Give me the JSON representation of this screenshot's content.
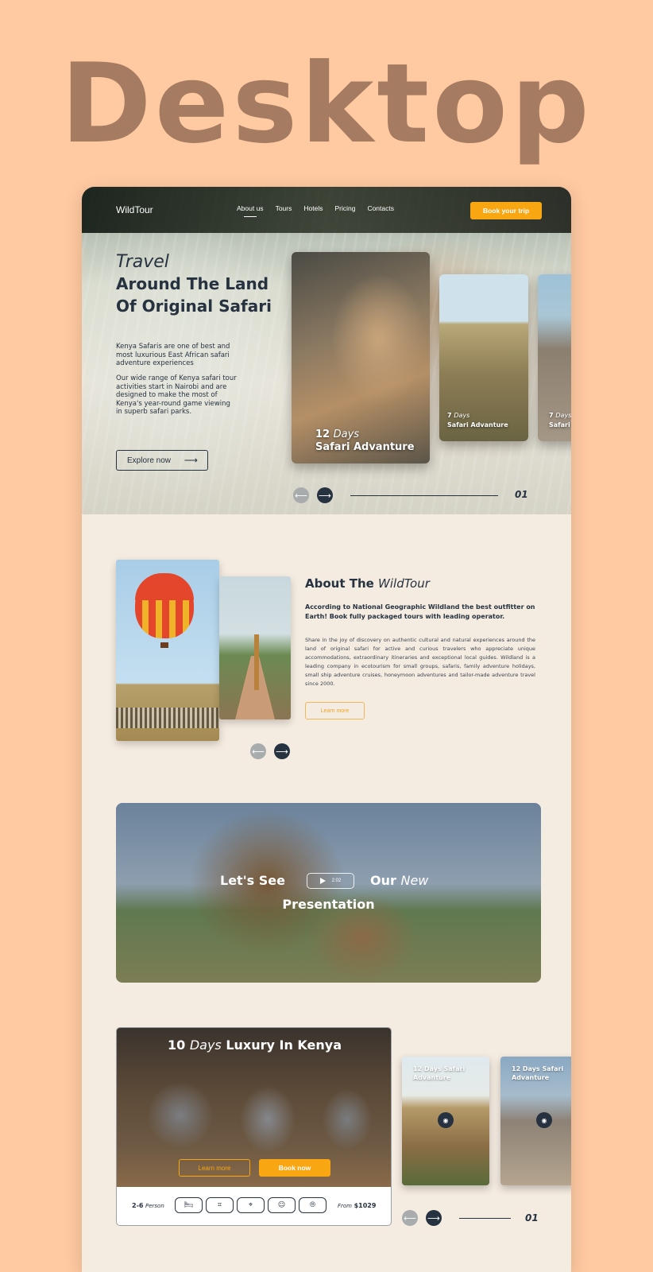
{
  "header": {
    "title": "Desktop"
  },
  "nav": {
    "logo": "WildTour",
    "items": [
      {
        "label": "About us"
      },
      {
        "label": "Tours"
      },
      {
        "label": "Hotels"
      },
      {
        "label": "Pricing"
      },
      {
        "label": "Contacts"
      }
    ],
    "cta": "Book your trip"
  },
  "hero": {
    "kicker": "Travel",
    "title": "Around The Land Of Original Safari",
    "p1": "Kenya Safaris are one of best and most luxurious East African safari adventure experiences",
    "p2": "Our wide range of Kenya safari tour activities start in Nairobi and are designed to make the most of Kenya's year-round game viewing in superb safari parks.",
    "button": "Explore now",
    "cards": [
      {
        "days": "12",
        "days_label": "Days",
        "name": "Safari Advanture"
      },
      {
        "days": "7",
        "days_label": "Days",
        "name": "Safari Advanture"
      },
      {
        "days": "7",
        "days_label": "Days",
        "name": "Safari"
      }
    ],
    "slide_number": "01"
  },
  "about": {
    "title": "About The",
    "title_italic": "WildTour",
    "lead": "According to National Geographic Wildland the best outfitter on Earth! Book fully packaged tours with leading operator.",
    "body": "Share in the joy of discovery on authentic cultural and natural experiences around the land of original safari for active and curious travelers who appreciate unique accommodations, extraordinary itineraries and exceptional local guides. Wildland is a leading company in ecotourism for small groups, safaris, family adventure holidays, small ship adventure cruises, honeymoon adventures and tailor-made adventure travel since 2000.",
    "button": "Learn more"
  },
  "video": {
    "text_left": "Let's See",
    "duration": "2:02",
    "text_right": "Our",
    "text_right_italic": "New",
    "text_bottom": "Presentation"
  },
  "tour": {
    "days": "10",
    "days_label": "Days",
    "title": "Luxury In Kenya",
    "learn": "Learn more",
    "book": "Book now",
    "persons": "2-6",
    "persons_label": "Person",
    "price_label": "From",
    "price": "$1029",
    "mini_cards": [
      {
        "label": "12 Days Safari Advanture"
      },
      {
        "label": "12 Days Safari Advanture"
      }
    ],
    "slide_number": "01"
  },
  "colors": {
    "accent": "#f8a612",
    "dark": "#263240",
    "page_bg": "#ffc9a1",
    "panel_bg": "#f5ece1"
  }
}
